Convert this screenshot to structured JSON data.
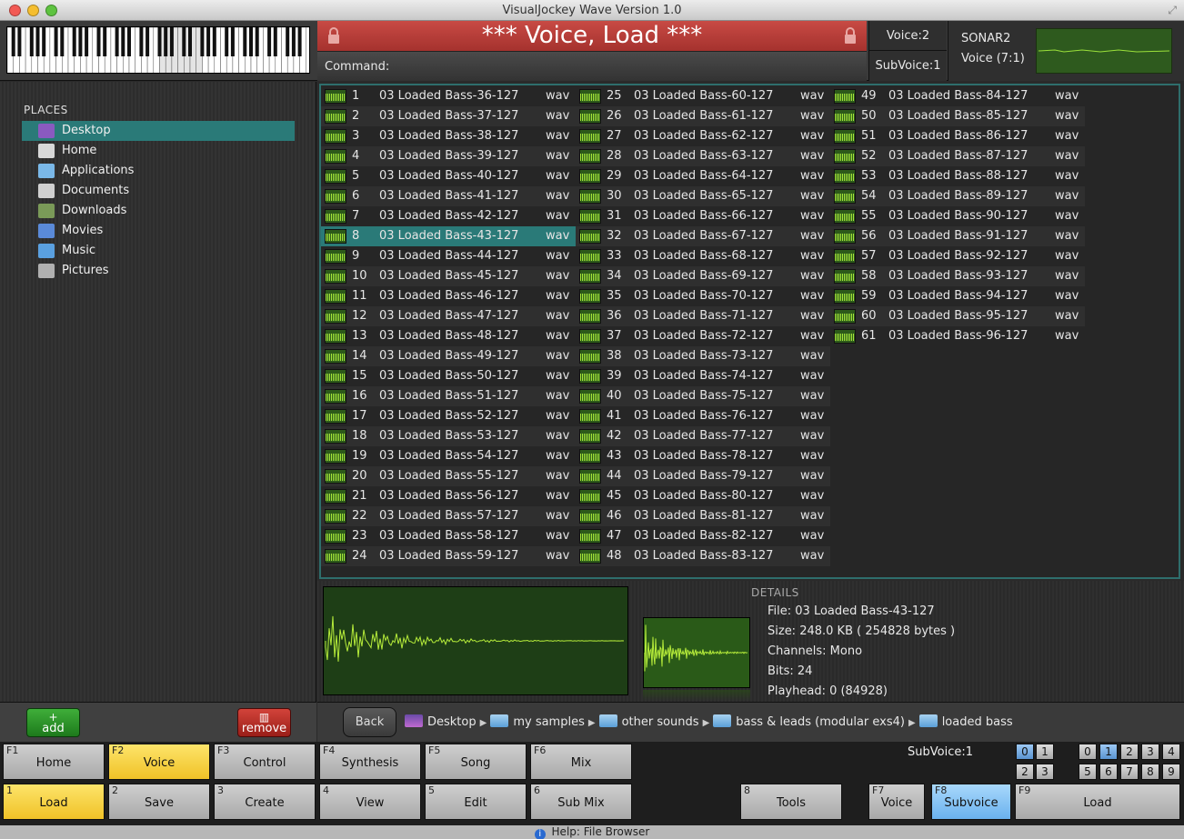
{
  "window": {
    "title": "VisualJockey Wave Version 1.0"
  },
  "command": {
    "title": "*** Voice, Load ***",
    "label": "Command:"
  },
  "voice_info": {
    "voice": "Voice:2",
    "subvoice": "SubVoice:1"
  },
  "sonar": {
    "name": "SONAR2",
    "voice": "Voice (7:1)"
  },
  "places": {
    "title": "PLACES",
    "items": [
      {
        "label": "Desktop",
        "icon": "desktop-icon",
        "color": "#8a5ac0"
      },
      {
        "label": "Home",
        "icon": "home-icon",
        "color": "#d8d8d8"
      },
      {
        "label": "Applications",
        "icon": "applications-icon",
        "color": "#7ab8e8"
      },
      {
        "label": "Documents",
        "icon": "documents-icon",
        "color": "#d0d0d0"
      },
      {
        "label": "Downloads",
        "icon": "downloads-icon",
        "color": "#7a9a58"
      },
      {
        "label": "Movies",
        "icon": "movies-icon",
        "color": "#5a8ad8"
      },
      {
        "label": "Music",
        "icon": "music-icon",
        "color": "#5aa0e0"
      },
      {
        "label": "Pictures",
        "icon": "pictures-icon",
        "color": "#b0b0b0"
      }
    ],
    "selected_index": 0
  },
  "files": {
    "selected": 8,
    "prefix": "03 Loaded Bass-",
    "suffix": "-127",
    "ext": "wav",
    "count": 61,
    "first_sample_id": 36
  },
  "details": {
    "title": "DETAILS",
    "file": "File: 03 Loaded Bass-43-127",
    "size": "Size: 248.0 KB  ( 254828 bytes )",
    "channels": "Channels: Mono",
    "bits": "Bits: 24",
    "playhead": "Playhead: 0  (84928)"
  },
  "buttons": {
    "add": "add",
    "remove": "remove",
    "back": "Back"
  },
  "path": [
    "Desktop",
    "my samples",
    "other sounds",
    "bass & leads (modular exs4)",
    "loaded bass"
  ],
  "fkeys_top": [
    {
      "key": "F1",
      "label": "Home"
    },
    {
      "key": "F2",
      "label": "Voice",
      "active": true
    },
    {
      "key": "F3",
      "label": "Control"
    },
    {
      "key": "F4",
      "label": "Synthesis"
    },
    {
      "key": "F5",
      "label": "Song"
    },
    {
      "key": "F6",
      "label": "Mix"
    }
  ],
  "fkeys_bottom": [
    {
      "key": "1",
      "label": "Load",
      "active": true
    },
    {
      "key": "2",
      "label": "Save"
    },
    {
      "key": "3",
      "label": "Create"
    },
    {
      "key": "4",
      "label": "View"
    },
    {
      "key": "5",
      "label": "Edit"
    },
    {
      "key": "6",
      "label": "Sub Mix"
    }
  ],
  "fkeys_right": [
    {
      "key": "8",
      "label": "Tools"
    },
    {
      "key": "F7",
      "label": "Voice"
    },
    {
      "key": "F8",
      "label": "Subvoice",
      "active": true
    },
    {
      "key": "F9",
      "label": "Load"
    }
  ],
  "subvoice_panel": {
    "title": "SubVoice:1",
    "group_a": [
      "0",
      "1",
      "2",
      "3"
    ],
    "group_a_active": "0",
    "group_b": [
      "0",
      "1",
      "2",
      "3",
      "4",
      "5",
      "6",
      "7",
      "8",
      "9"
    ],
    "group_b_active": "1"
  },
  "help": {
    "text": "Help: File Browser",
    "icon": "info-icon"
  },
  "colors": {
    "accent": "#2a7a78",
    "command_red": "#b83a35",
    "active_yellow": "#f5d040",
    "active_blue": "#8cc4f8",
    "wave_green": "#a6e83a"
  }
}
